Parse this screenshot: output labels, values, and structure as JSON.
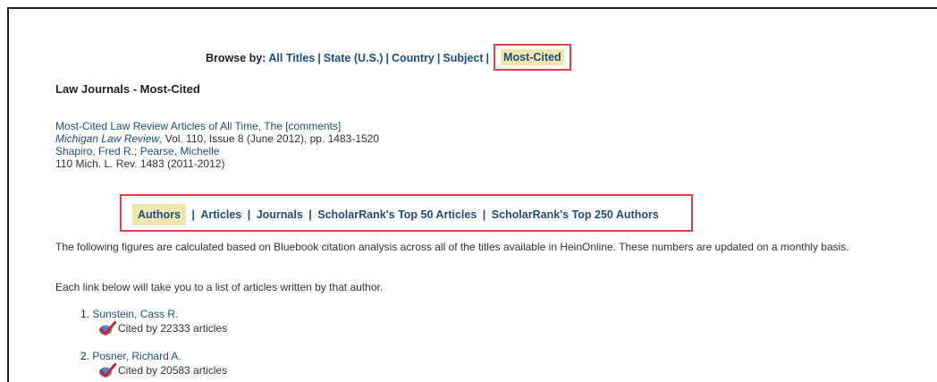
{
  "browse": {
    "label": "Browse by:",
    "links": [
      "All Titles",
      "State (U.S.)",
      "Country",
      "Subject"
    ],
    "active": "Most-Cited"
  },
  "page_heading": "Law Journals - Most-Cited",
  "citation": {
    "title": "Most-Cited Law Review Articles of All Time, The [comments]",
    "journal": "Michigan Law Review",
    "details": ", Vol. 110, Issue 8 (June 2012), pp. 1483-1520",
    "authors": "Shapiro, Fred R.; Pearse, Michelle",
    "reference": "110 Mich. L. Rev. 1483 (2011-2012)"
  },
  "tabs": {
    "active": "Authors",
    "items": [
      "Articles",
      "Journals",
      "ScholarRank's Top 50 Articles",
      "ScholarRank's Top 250 Authors"
    ]
  },
  "description": "The following figures are calculated based on Bluebook citation analysis across all of the titles available in HeinOnline. These numbers are updated on a monthly basis.",
  "instruction": "Each link below will take you to a list of articles written by that author.",
  "authors": [
    {
      "rank": "1.",
      "name": "Sunstein, Cass R.",
      "cited": "Cited by 22333 articles"
    },
    {
      "rank": "2.",
      "name": "Posner, Richard A.",
      "cited": "Cited by 20583 articles"
    }
  ],
  "colors": {
    "link": "#1f4e79",
    "highlight_box": "#e0404a",
    "highlight_fill": "#efe6b0"
  }
}
